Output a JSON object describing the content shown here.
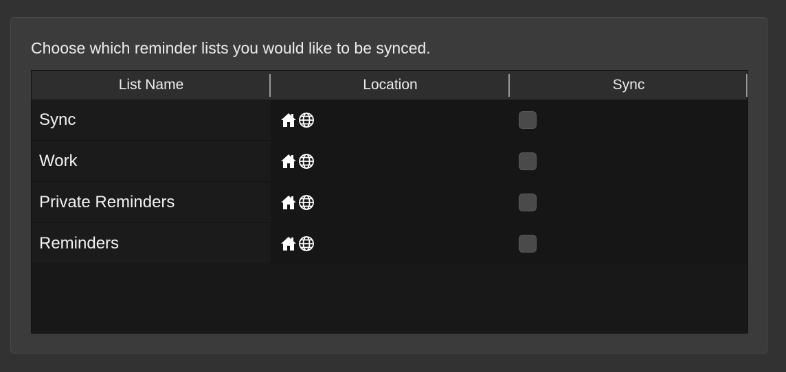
{
  "instruction": "Choose which reminder lists you would like to be synced.",
  "table": {
    "columns": [
      "List Name",
      "Location",
      "Sync"
    ],
    "rows": [
      {
        "name": "Sync",
        "location_icons": [
          "home-icon",
          "globe-icon"
        ],
        "sync": false
      },
      {
        "name": "Work",
        "location_icons": [
          "home-icon",
          "globe-icon"
        ],
        "sync": false
      },
      {
        "name": "Private Reminders",
        "location_icons": [
          "home-icon",
          "globe-icon"
        ],
        "sync": false
      },
      {
        "name": "Reminders",
        "location_icons": [
          "home-icon",
          "globe-icon"
        ],
        "sync": false
      }
    ]
  },
  "colors": {
    "background": "#323232",
    "panel": "#3b3b3b",
    "table_body": "#181818",
    "header": "#2e2e2e",
    "checkbox": "#4a4a4a"
  }
}
